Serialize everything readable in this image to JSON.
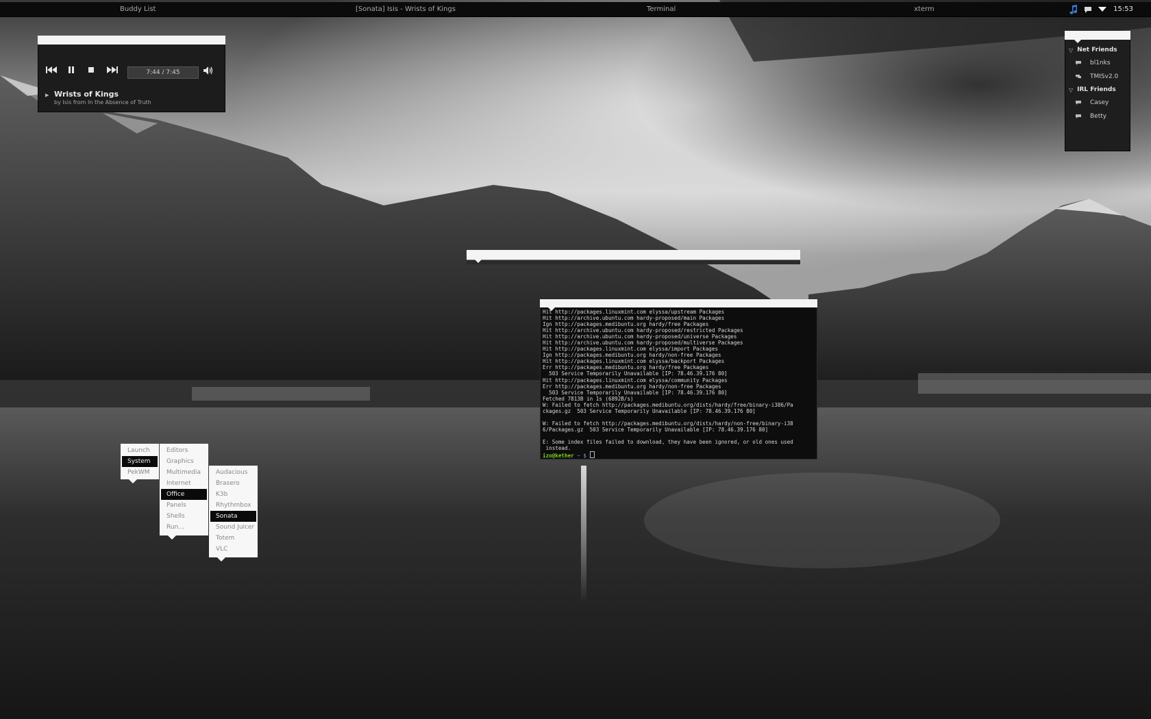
{
  "panel": {
    "tasks": [
      "Buddy List",
      "[Sonata] Isis - Wrists of Kings",
      "Terminal",
      "xterm"
    ],
    "tray_icons": [
      "music-note-icon",
      "chat-bubble-icon"
    ],
    "clock": "15:53"
  },
  "player": {
    "time": "7:44 / 7:45",
    "track_title": "Wrists of Kings",
    "track_subtitle": "by Isis from In the Absence of Truth",
    "controls": [
      "previous-icon",
      "pause-icon",
      "stop-icon",
      "next-icon",
      "volume-icon"
    ]
  },
  "buddy_list": {
    "groups": [
      {
        "name": "Net Friends",
        "buddies": [
          {
            "name": "bl1nks",
            "icon": "chat-bubble-icon"
          },
          {
            "name": "TMISv2.0",
            "icon": "chat-bubbles-icon"
          }
        ]
      },
      {
        "name": "IRL Friends",
        "buddies": [
          {
            "name": "Casey",
            "icon": "chat-bubble-icon"
          },
          {
            "name": "Betty",
            "icon": "chat-bubble-icon"
          }
        ]
      }
    ]
  },
  "terminal": {
    "lines": [
      "Hit http://packages.linuxmint.com elyssa/upstream Packages",
      "Hit http://archive.ubuntu.com hardy-proposed/main Packages",
      "Ign http://packages.medibuntu.org hardy/free Packages",
      "Hit http://archive.ubuntu.com hardy-proposed/restricted Packages",
      "Hit http://archive.ubuntu.com hardy-proposed/universe Packages",
      "Hit http://archive.ubuntu.com hardy-proposed/multiverse Packages",
      "Hit http://packages.linuxmint.com elyssa/import Packages",
      "Ign http://packages.medibuntu.org hardy/non-free Packages",
      "Hit http://packages.linuxmint.com elyssa/backport Packages",
      "Err http://packages.medibuntu.org hardy/free Packages",
      "  503 Service Temporarily Unavailable [IP: 78.46.39.176 80]",
      "Hit http://packages.linuxmint.com elyssa/community Packages",
      "Err http://packages.medibuntu.org hardy/non-free Packages",
      "  503 Service Temporarily Unavailable [IP: 78.46.39.176 80]",
      "Fetched 7813B in 1s (6892B/s)",
      "W: Failed to fetch http://packages.medibuntu.org/dists/hardy/free/binary-i386/Pa",
      "ckages.gz  503 Service Temporarily Unavailable [IP: 78.46.39.176 80]",
      "",
      "W: Failed to fetch http://packages.medibuntu.org/dists/hardy/non-free/binary-i38",
      "6/Packages.gz  503 Service Temporarily Unavailable [IP: 78.46.39.176 80]",
      "",
      "E: Some index files failed to download, they have been ignored, or old ones used",
      " instead."
    ],
    "prompt_user": "izo@kether",
    "prompt_rest": " ~ $"
  },
  "menus": {
    "root": {
      "items": [
        "Launch",
        "System",
        "PekWM"
      ],
      "selected": "System"
    },
    "system": {
      "items": [
        "Editors",
        "Graphics",
        "Multimedia",
        "Internet",
        "Office",
        "Panels",
        "Shells",
        "Run..."
      ],
      "selected": "Office"
    },
    "office": {
      "items": [
        "Audacious",
        "Brasero",
        "K3b",
        "Rhythmbox",
        "Sonata",
        "Sound Juicer",
        "Totem",
        "VLC"
      ],
      "selected": "Sonata"
    }
  }
}
